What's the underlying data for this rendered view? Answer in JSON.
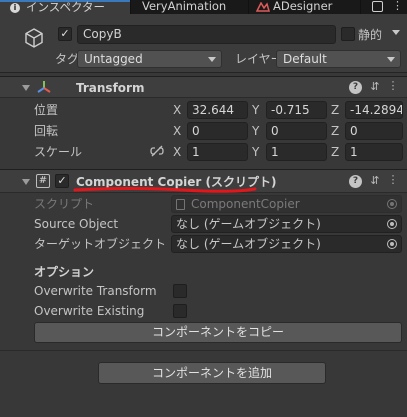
{
  "tabs": [
    {
      "label": "インスペクター",
      "active": true
    },
    {
      "label": "VeryAnimation",
      "active": false
    },
    {
      "label": "ADesigner",
      "active": false
    }
  ],
  "object": {
    "name": "CopyB",
    "active": true,
    "static_label": "静的",
    "tag_label": "タグ",
    "tag_value": "Untagged",
    "layer_label": "レイヤー",
    "layer_value": "Default"
  },
  "transform": {
    "title": "Transform",
    "rows": [
      {
        "label": "位置",
        "x": "32.644",
        "y": "-0.715",
        "z": "-14.2894"
      },
      {
        "label": "回転",
        "x": "0",
        "y": "0",
        "z": "0"
      },
      {
        "label": "スケール",
        "x": "1",
        "y": "1",
        "z": "1"
      }
    ],
    "axes": [
      "X",
      "Y",
      "Z"
    ]
  },
  "copier": {
    "title": "Component Copier (スクリプト)",
    "enabled": true,
    "script_label": "スクリプト",
    "script_value": "ComponentCopier",
    "source_label": "Source Object",
    "source_value": "なし (ゲームオブジェクト)",
    "target_label": "ターゲットオブジェクト",
    "target_value": "なし (ゲームオブジェクト)",
    "options_header": "オプション",
    "overwrite_transform_label": "Overwrite Transform",
    "overwrite_existing_label": "Overwrite Existing",
    "copy_button": "コンポーネントをコピー"
  },
  "add_component_button": "コンポーネントを追加",
  "colors": {
    "annotation_underline": "#e3161b",
    "active_tab_accent": "#3a79bb"
  }
}
